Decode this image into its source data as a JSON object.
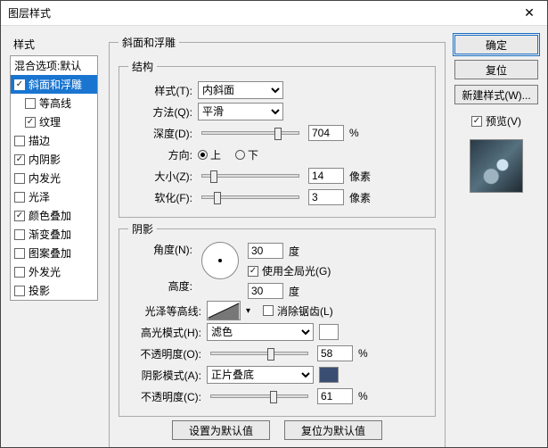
{
  "window": {
    "title": "图层样式",
    "close": "✕"
  },
  "cols": {
    "styles_header": "样式",
    "blend_default": "混合选项:默认"
  },
  "styles": [
    {
      "label": "斜面和浮雕",
      "checked": true,
      "selected": true,
      "indent": false
    },
    {
      "label": "等高线",
      "checked": false,
      "selected": false,
      "indent": true
    },
    {
      "label": "纹理",
      "checked": true,
      "selected": false,
      "indent": true
    },
    {
      "label": "描边",
      "checked": false,
      "selected": false,
      "indent": false
    },
    {
      "label": "内阴影",
      "checked": true,
      "selected": false,
      "indent": false
    },
    {
      "label": "内发光",
      "checked": false,
      "selected": false,
      "indent": false
    },
    {
      "label": "光泽",
      "checked": false,
      "selected": false,
      "indent": false
    },
    {
      "label": "颜色叠加",
      "checked": true,
      "selected": false,
      "indent": false
    },
    {
      "label": "渐变叠加",
      "checked": false,
      "selected": false,
      "indent": false
    },
    {
      "label": "图案叠加",
      "checked": false,
      "selected": false,
      "indent": false
    },
    {
      "label": "外发光",
      "checked": false,
      "selected": false,
      "indent": false
    },
    {
      "label": "投影",
      "checked": false,
      "selected": false,
      "indent": false
    }
  ],
  "bevel": {
    "group": "斜面和浮雕",
    "structure": "结构",
    "style_lbl": "样式(T):",
    "style_val": "内斜面",
    "tech_lbl": "方法(Q):",
    "tech_val": "平滑",
    "depth_lbl": "深度(D):",
    "depth_val": "704",
    "pct": "%",
    "dir_lbl": "方向:",
    "dir_up": "上",
    "dir_down": "下",
    "size_lbl": "大小(Z):",
    "size_val": "14",
    "px": "像素",
    "soften_lbl": "软化(F):",
    "soften_val": "3"
  },
  "shade": {
    "group": "阴影",
    "angle_lbl": "角度(N):",
    "angle_val": "30",
    "deg": "度",
    "global": "使用全局光(G)",
    "alt_lbl": "高度:",
    "alt_val": "30",
    "gloss_lbl": "光泽等高线:",
    "aa": "消除锯齿(L)",
    "hmode_lbl": "高光模式(H):",
    "hmode_val": "滤色",
    "hopac_lbl": "不透明度(O):",
    "hopac_val": "58",
    "smode_lbl": "阴影模式(A):",
    "smode_val": "正片叠底",
    "sopac_lbl": "不透明度(C):",
    "sopac_val": "61"
  },
  "bottom": {
    "make_default": "设置为默认值",
    "reset_default": "复位为默认值"
  },
  "right": {
    "ok": "确定",
    "cancel": "复位",
    "new_style": "新建样式(W)...",
    "preview": "预览(V)"
  }
}
